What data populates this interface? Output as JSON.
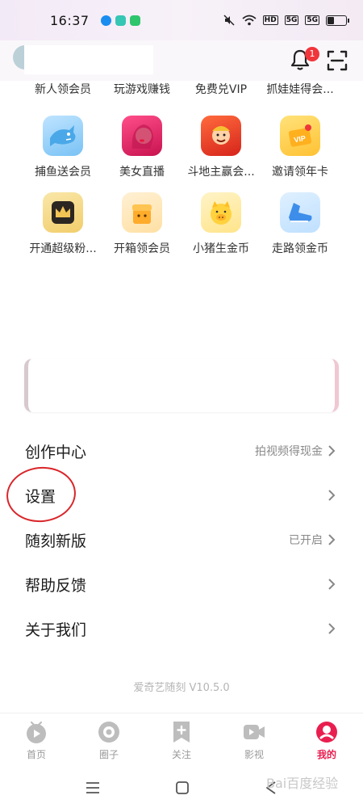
{
  "status_bar": {
    "time": "16:37",
    "signal_label": "HD",
    "network_1": "5G",
    "network_2": "5G"
  },
  "header": {
    "notification_count": "1"
  },
  "grid": {
    "top_labels": [
      "新人领会员",
      "玩游戏赚钱",
      "免费兑VIP",
      "抓娃娃得会..."
    ],
    "rows": [
      [
        {
          "label": "捕鱼送会员",
          "icon": "shark-icon"
        },
        {
          "label": "美女直播",
          "icon": "live-girl-icon"
        },
        {
          "label": "斗地主赢会...",
          "icon": "card-game-icon"
        },
        {
          "label": "邀请领年卡",
          "icon": "vip-card-icon"
        }
      ],
      [
        {
          "label": "开通超级粉...",
          "icon": "crown-icon"
        },
        {
          "label": "开箱领会员",
          "icon": "gift-box-icon"
        },
        {
          "label": "小猪生金币",
          "icon": "pig-icon"
        },
        {
          "label": "走路领金币",
          "icon": "sneaker-icon"
        }
      ]
    ]
  },
  "menu": {
    "items": [
      {
        "label": "创作中心",
        "hint": "拍视频得现金"
      },
      {
        "label": "设置",
        "hint": ""
      },
      {
        "label": "随刻新版",
        "hint": "已开启"
      },
      {
        "label": "帮助反馈",
        "hint": ""
      },
      {
        "label": "关于我们",
        "hint": ""
      }
    ]
  },
  "version": "爱奇艺随刻 V10.5.0",
  "tabbar": {
    "tabs": [
      {
        "label": "首页",
        "icon": "home-tv-icon",
        "active": false
      },
      {
        "label": "圈子",
        "icon": "circle-icon",
        "active": false
      },
      {
        "label": "关注",
        "icon": "follow-icon",
        "active": false
      },
      {
        "label": "影视",
        "icon": "video-icon",
        "active": false
      },
      {
        "label": "我的",
        "icon": "profile-icon",
        "active": true
      }
    ]
  },
  "colors": {
    "accent": "#e91e4f",
    "highlight_circle": "#d9262a",
    "badge": "#f0353b"
  },
  "watermark": "Bai百度经验"
}
